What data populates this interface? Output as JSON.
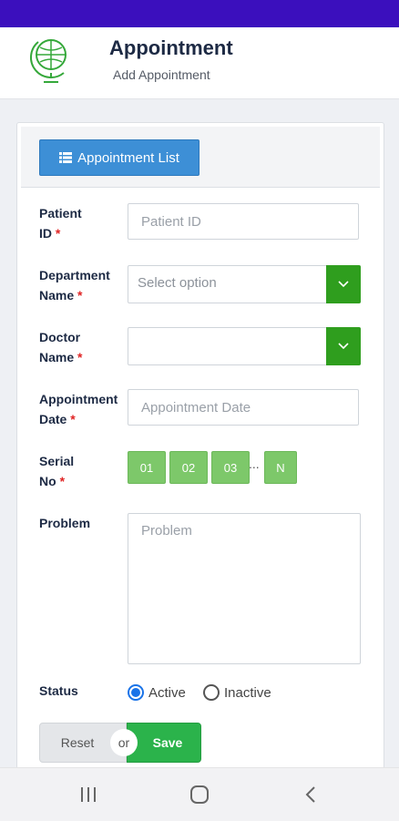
{
  "colors": {
    "status_bar": "#3b0fbd",
    "primary": "#3d8fd6",
    "success": "#2bb34b",
    "serial": "#7dc86a",
    "select_arrow": "#2f9e1e"
  },
  "header": {
    "title": "Appointment",
    "subtitle": "Add Appointment",
    "logo_icon": "globe-logo-icon"
  },
  "toolbar": {
    "list_button_label": "Appointment List",
    "list_icon": "list-icon"
  },
  "form": {
    "patient_id": {
      "label": "Patient\nID",
      "required_mark": "*",
      "placeholder": "Patient ID",
      "value": ""
    },
    "department": {
      "label": "Department\nName",
      "required_mark": "*",
      "selected": "Select option"
    },
    "doctor": {
      "label": "Doctor\nName",
      "required_mark": "*",
      "selected": ""
    },
    "date": {
      "label": "Appointment\nDate",
      "required_mark": "*",
      "placeholder": "Appointment Date",
      "value": ""
    },
    "serial": {
      "label": "Serial\nNo",
      "required_mark": "*",
      "options": [
        "01",
        "02",
        "03",
        "N"
      ],
      "ellipsis": "..."
    },
    "problem": {
      "label": "Problem",
      "placeholder": "Problem",
      "value": ""
    },
    "status": {
      "label": "Status",
      "options": [
        "Active",
        "Inactive"
      ],
      "selected": "Active"
    }
  },
  "buttons": {
    "reset": "Reset",
    "or": "or",
    "save": "Save"
  },
  "navbar": {
    "icons": [
      "recent-apps-icon",
      "home-icon",
      "back-icon"
    ]
  }
}
